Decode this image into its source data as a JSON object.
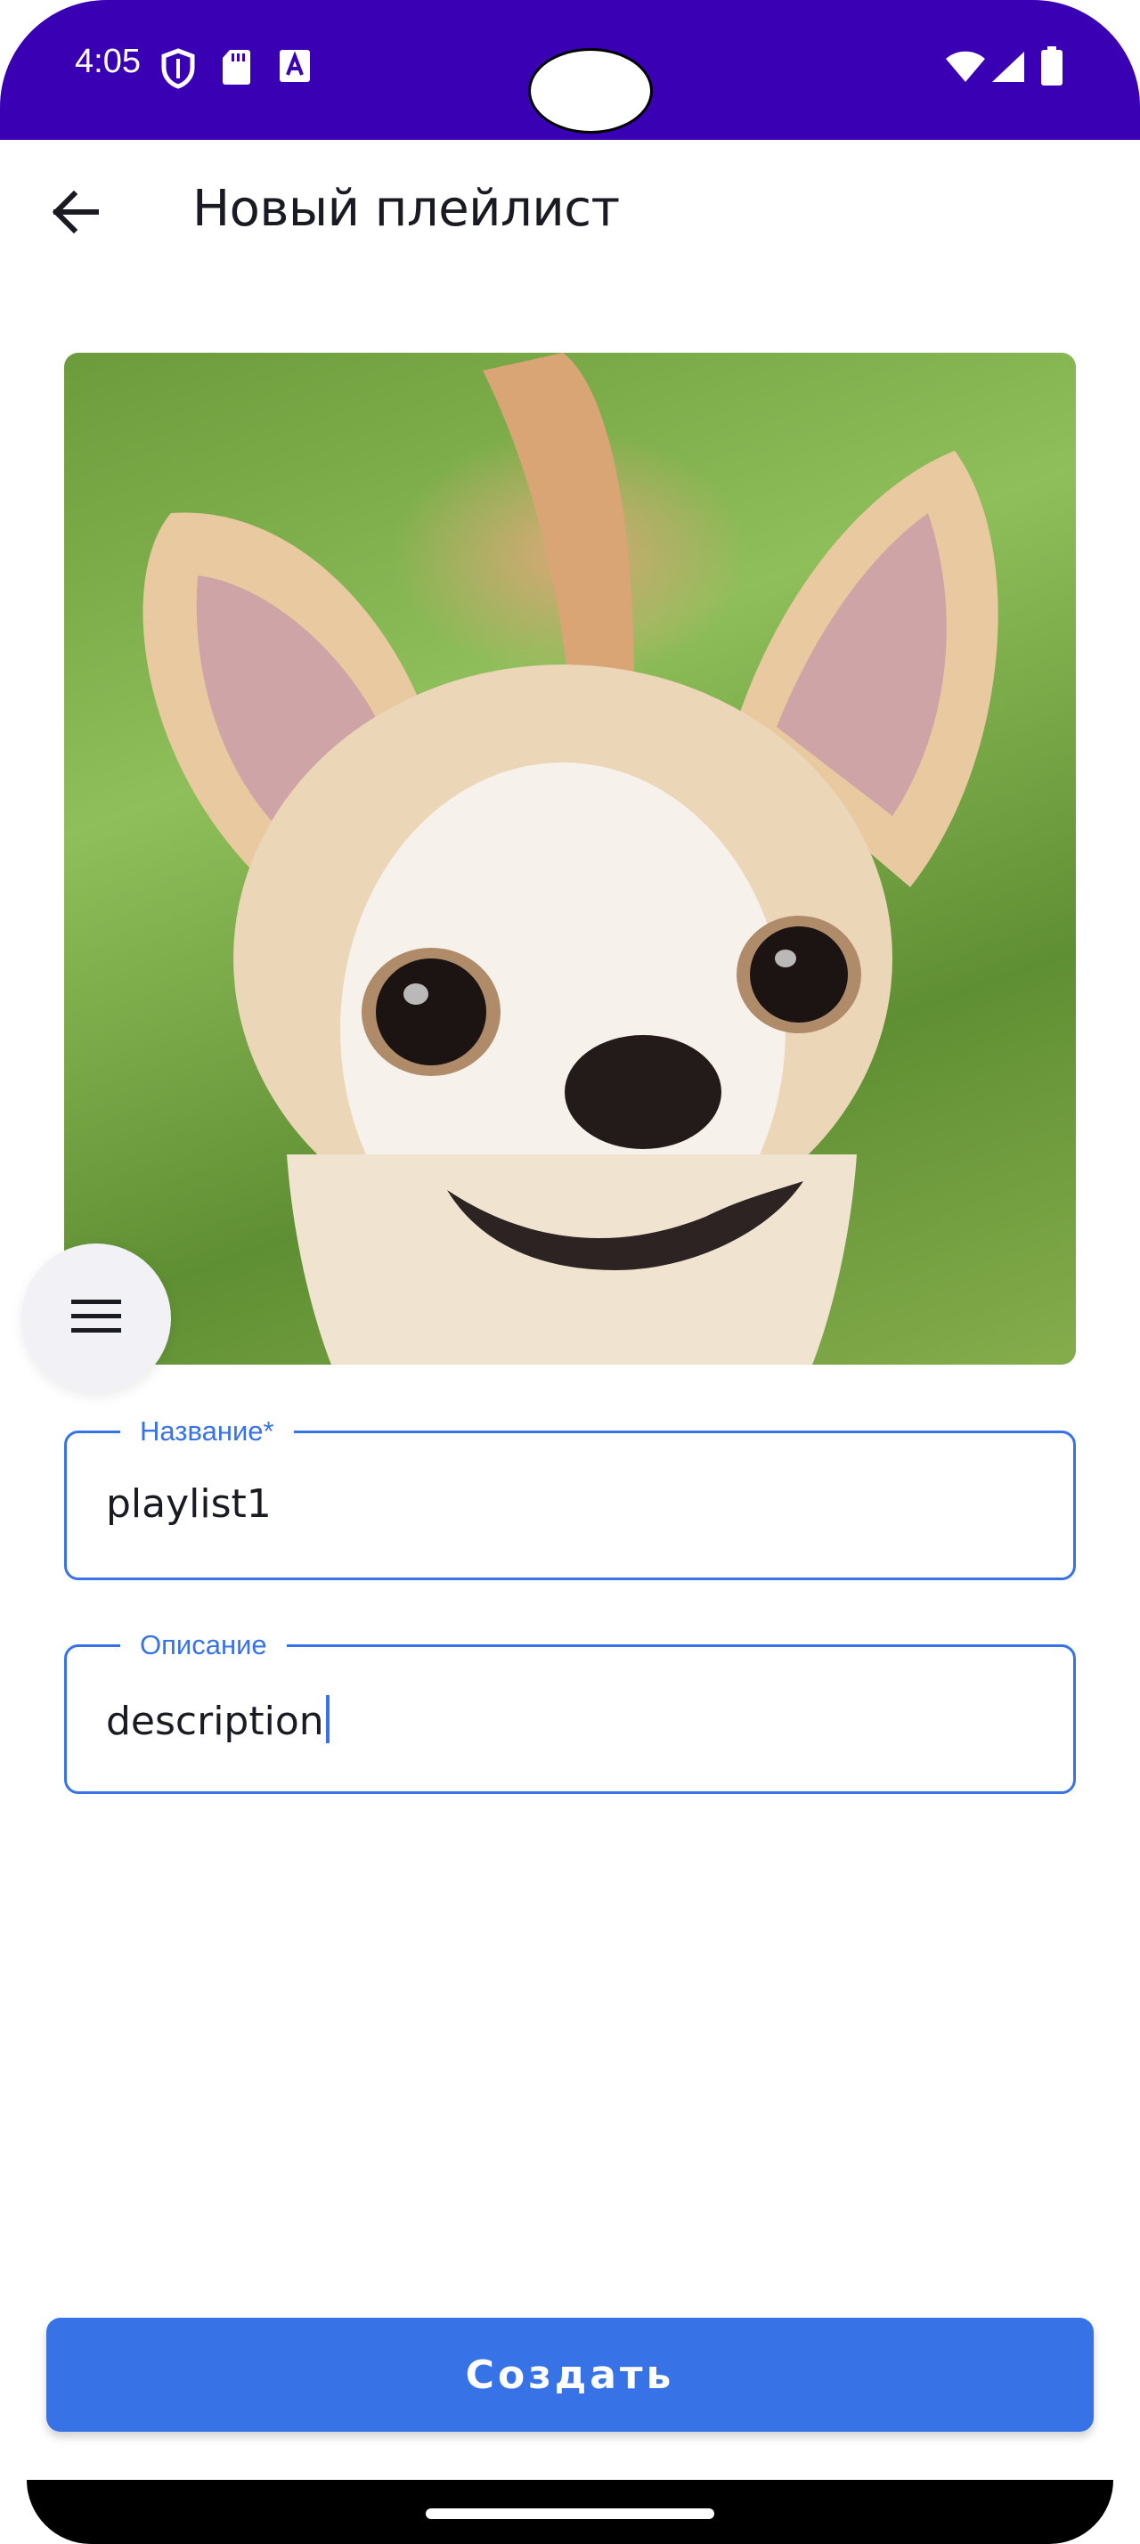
{
  "status_bar": {
    "time": "4:05",
    "left_icons": [
      "shield-icon",
      "sd-card-icon",
      "text-a-icon"
    ],
    "right_icons": [
      "wifi-icon",
      "signal-icon",
      "battery-icon"
    ],
    "background_color": "#3a00b4"
  },
  "header": {
    "back_icon": "arrow-left-icon",
    "title": "Новый плейлист"
  },
  "cover_image": {
    "subject": "chihuahua photo"
  },
  "menu_button": {
    "icon": "hamburger-icon"
  },
  "form": {
    "name_field": {
      "label": "Название*",
      "value": "playlist1"
    },
    "description_field": {
      "label": "Описание",
      "value": "description"
    }
  },
  "create_button": {
    "label": "Создать"
  },
  "colors": {
    "accent": "#3772e7",
    "title_text": "#1a1b22"
  }
}
